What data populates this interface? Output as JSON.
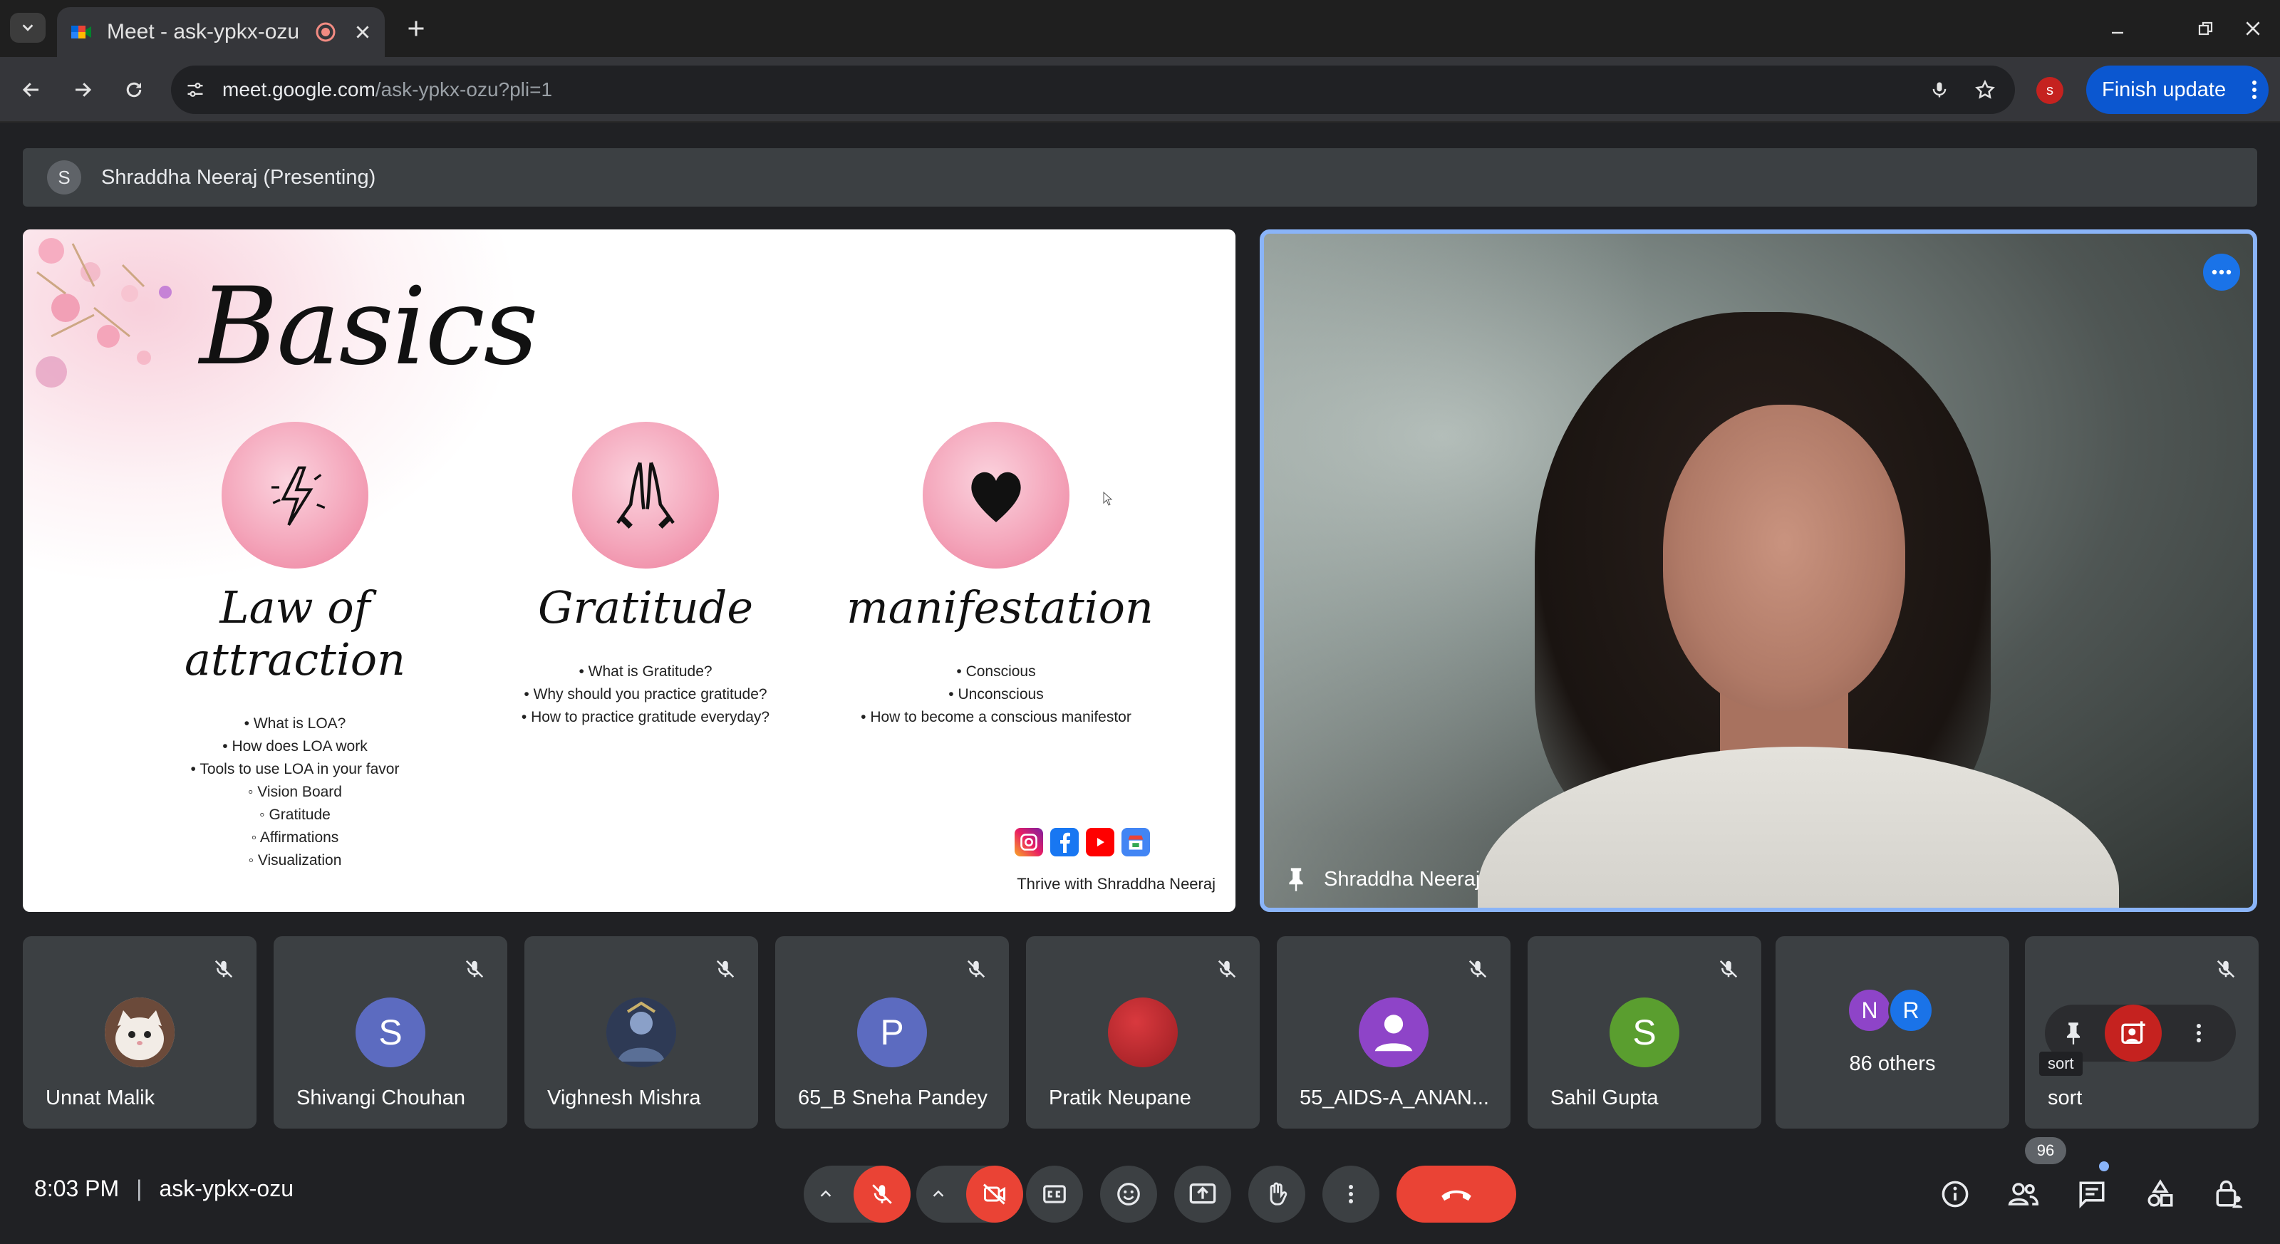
{
  "browser": {
    "tab_title": "Meet - ask-ypkx-ozu",
    "url_host": "meet.google.com",
    "url_path": "/ask-ypkx-ozu?pli=1",
    "profile_initial": "s",
    "finish_update_label": "Finish update"
  },
  "meet": {
    "presenting_avatar_initial": "S",
    "presenting_label": "Shraddha Neeraj (Presenting)",
    "slide": {
      "title": "Basics",
      "topics": [
        {
          "heading": "Law of attraction",
          "bullets": [
            "What is LOA?",
            "How does LOA work",
            "Tools to use LOA in your favor"
          ],
          "sub_bullets": [
            "Vision Board",
            "Gratitude",
            "Affirmations",
            "Visualization"
          ]
        },
        {
          "heading": "Gratitude",
          "bullets": [
            "What is Gratitude?",
            "Why should you practice gratitude?",
            "How to practice gratitude everyday?"
          ],
          "sub_bullets": []
        },
        {
          "heading": "manifestation",
          "bullets": [
            "Conscious",
            "Unconscious",
            "How to become a conscious manifestor"
          ],
          "sub_bullets": []
        }
      ],
      "footer": "Thrive with Shraddha Neeraj"
    },
    "speaker_name": "Shraddha Neeraj",
    "participants": [
      {
        "name": "Unnat Malik",
        "initial": "",
        "color": "#c4a59a"
      },
      {
        "name": "Shivangi Chouhan",
        "initial": "S",
        "color": "#5c6bc0"
      },
      {
        "name": "Vighnesh Mishra",
        "initial": "",
        "color": "#4a5a7a"
      },
      {
        "name": "65_B Sneha Pandey",
        "initial": "P",
        "color": "#5c6bc0"
      },
      {
        "name": "Pratik Neupane",
        "initial": "",
        "color": "#b3262b"
      },
      {
        "name": "55_AIDS-A_ANAN...",
        "initial": "",
        "color": "#8e44c8"
      },
      {
        "name": "Sahil Gupta",
        "initial": "S",
        "color": "#5a9e2f"
      }
    ],
    "others": {
      "label": "86 others",
      "avatars": [
        "N",
        "R"
      ]
    },
    "last_tile_name": "sort",
    "sort_tooltip": "sort",
    "time": "8:03 PM",
    "meeting_code": "ask-ypkx-ozu",
    "people_count": "96"
  }
}
